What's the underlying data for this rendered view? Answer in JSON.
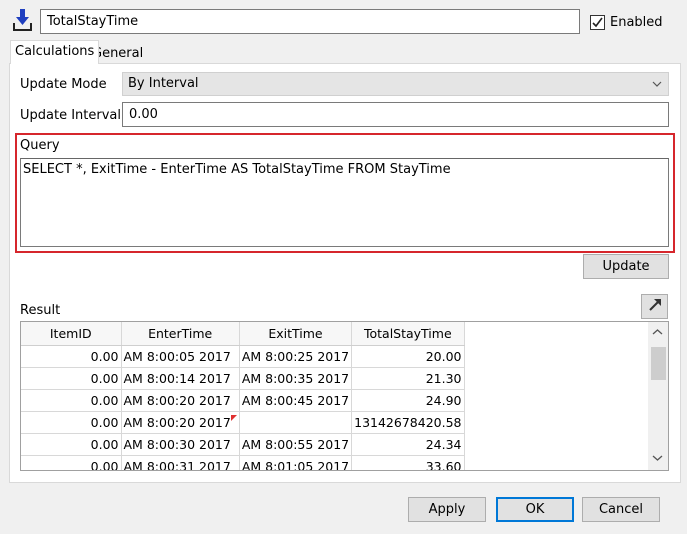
{
  "header": {
    "name_value": "TotalStayTime",
    "enabled_label": "Enabled",
    "enabled_checked": true
  },
  "tabs": [
    {
      "label": "Calculations",
      "active": true
    },
    {
      "label": "General",
      "active": false
    }
  ],
  "form": {
    "update_mode_label": "Update Mode",
    "update_mode_value": "By Interval",
    "update_interval_label": "Update Interval",
    "update_interval_value": "0.00"
  },
  "query": {
    "label": "Query",
    "text": "SELECT *, ExitTime - EnterTime AS TotalStayTime FROM StayTime",
    "update_button": "Update"
  },
  "result": {
    "label": "Result",
    "columns": [
      "ItemID",
      "EnterTime",
      "ExitTime",
      "TotalStayTime"
    ],
    "rows": [
      [
        "0.00",
        "2017 8:00:05 AM",
        "2017 8:00:25 AM",
        "20.00"
      ],
      [
        "0.00",
        "2017 8:00:14 AM",
        "2017 8:00:35 AM",
        "21.30"
      ],
      [
        "0.00",
        "2017 8:00:20 AM",
        "2017 8:00:45 AM",
        "24.90"
      ],
      [
        "0.00",
        "2017 8:00:20 AM",
        "",
        "13142678420.58"
      ],
      [
        "0.00",
        "2017 8:00:30 AM",
        "2017 8:00:55 AM",
        "24.34"
      ],
      [
        "0.00",
        "2017 8:00:31 AM",
        "2017 8:01:05 AM",
        "33.60"
      ]
    ]
  },
  "footer": {
    "apply": "Apply",
    "ok": "OK",
    "cancel": "Cancel"
  },
  "colors": {
    "highlight_border": "#d6262c",
    "default_button_border": "#0078d7",
    "download_icon": "#1f3fbf"
  },
  "icons": {
    "top_icon": "download-arrow-icon",
    "check": "checkmark-icon",
    "dropdown": "chevron-down-icon",
    "expand": "expand-arrow-icon",
    "scroll_up": "scroll-up-icon",
    "scroll_down": "scroll-down-icon"
  }
}
